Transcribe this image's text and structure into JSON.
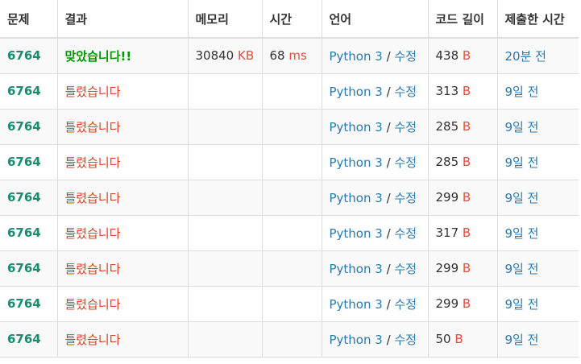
{
  "headers": {
    "problem": "문제",
    "result": "결과",
    "memory": "메모리",
    "time": "시간",
    "language": "언어",
    "code_length": "코드 길이",
    "submitted": "제출한 시간"
  },
  "rows": [
    {
      "problem": "6764",
      "result": "맞았습니다!!",
      "result_type": "ac",
      "memory": "30840",
      "memory_unit": "KB",
      "time": "68",
      "time_unit": "ms",
      "language": "Python 3",
      "separator": "/",
      "edit": "수정",
      "length": "438",
      "length_unit": "B",
      "submitted": "20분 전"
    },
    {
      "problem": "6764",
      "result": "틀렸습니다",
      "result_type": "wa",
      "memory": "",
      "memory_unit": "",
      "time": "",
      "time_unit": "",
      "language": "Python 3",
      "separator": "/",
      "edit": "수정",
      "length": "313",
      "length_unit": "B",
      "submitted": "9일 전"
    },
    {
      "problem": "6764",
      "result": "틀렸습니다",
      "result_type": "wa",
      "memory": "",
      "memory_unit": "",
      "time": "",
      "time_unit": "",
      "language": "Python 3",
      "separator": "/",
      "edit": "수정",
      "length": "285",
      "length_unit": "B",
      "submitted": "9일 전"
    },
    {
      "problem": "6764",
      "result": "틀렸습니다",
      "result_type": "wa",
      "memory": "",
      "memory_unit": "",
      "time": "",
      "time_unit": "",
      "language": "Python 3",
      "separator": "/",
      "edit": "수정",
      "length": "285",
      "length_unit": "B",
      "submitted": "9일 전"
    },
    {
      "problem": "6764",
      "result": "틀렸습니다",
      "result_type": "wa",
      "memory": "",
      "memory_unit": "",
      "time": "",
      "time_unit": "",
      "language": "Python 3",
      "separator": "/",
      "edit": "수정",
      "length": "299",
      "length_unit": "B",
      "submitted": "9일 전"
    },
    {
      "problem": "6764",
      "result": "틀렸습니다",
      "result_type": "wa",
      "memory": "",
      "memory_unit": "",
      "time": "",
      "time_unit": "",
      "language": "Python 3",
      "separator": "/",
      "edit": "수정",
      "length": "317",
      "length_unit": "B",
      "submitted": "9일 전"
    },
    {
      "problem": "6764",
      "result": "틀렸습니다",
      "result_type": "wa",
      "memory": "",
      "memory_unit": "",
      "time": "",
      "time_unit": "",
      "language": "Python 3",
      "separator": "/",
      "edit": "수정",
      "length": "299",
      "length_unit": "B",
      "submitted": "9일 전"
    },
    {
      "problem": "6764",
      "result": "틀렸습니다",
      "result_type": "wa",
      "memory": "",
      "memory_unit": "",
      "time": "",
      "time_unit": "",
      "language": "Python 3",
      "separator": "/",
      "edit": "수정",
      "length": "299",
      "length_unit": "B",
      "submitted": "9일 전"
    },
    {
      "problem": "6764",
      "result": "틀렸습니다",
      "result_type": "wa",
      "memory": "",
      "memory_unit": "",
      "time": "",
      "time_unit": "",
      "language": "Python 3",
      "separator": "/",
      "edit": "수정",
      "length": "50",
      "length_unit": "B",
      "submitted": "9일 전"
    }
  ],
  "colors": {
    "problem_link": "#1b8b6e",
    "accepted": "#009800",
    "wrong": "#dd4124",
    "unit": "#e74c3c",
    "link": "#2a7ab0",
    "border": "#dddddd",
    "row_stripe": "#f9f9f9"
  }
}
